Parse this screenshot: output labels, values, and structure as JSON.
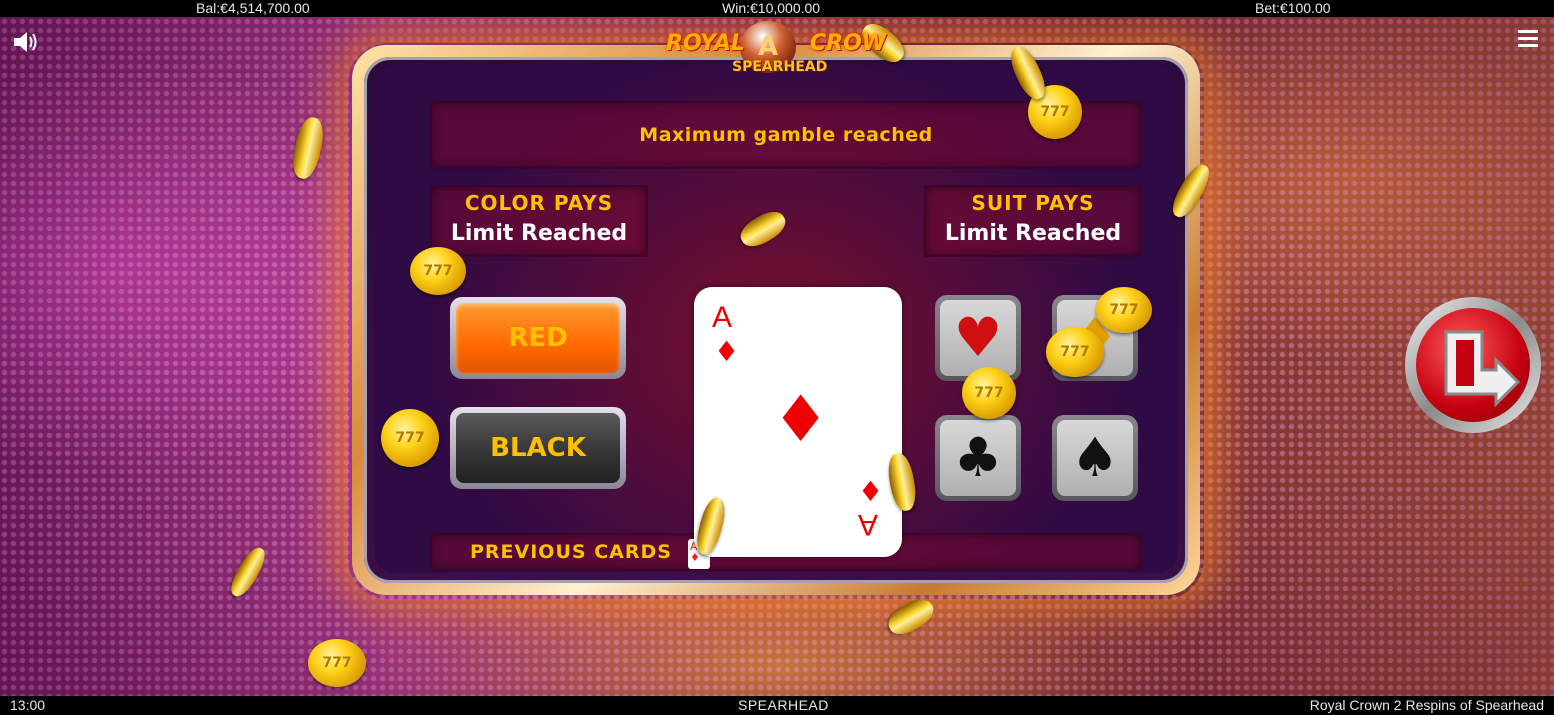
{
  "header": {
    "balance": "Bal:€4,514,700.00",
    "win": "Win:€10,000.00",
    "bet": "Bet:€100.00"
  },
  "logo": {
    "word1": "ROYAL",
    "word2": "CROW",
    "orb_letter": "A",
    "brand": "SPEARHEAD"
  },
  "gamble": {
    "message": "Maximum gamble reached",
    "color_pays": {
      "title": "COLOR PAYS",
      "value": "Limit Reached"
    },
    "suit_pays": {
      "title": "SUIT PAYS",
      "value": "Limit Reached"
    },
    "red_label": "RED",
    "black_label": "BLACK",
    "previous_cards_label": "PREVIOUS CARDS",
    "card": {
      "rank": "A",
      "suit": "♦"
    },
    "previous_card": {
      "rank": "A",
      "suit": "♦"
    },
    "suits": {
      "hearts": "♥",
      "diamonds": "♦",
      "clubs": "♣",
      "spades": "♠"
    }
  },
  "coin_glyph": "777",
  "icons": {
    "speaker": "speaker-icon",
    "menu": "hamburger-menu-icon",
    "exit": "exit-arrow-icon"
  },
  "footer": {
    "time": "13:00",
    "brand": "SPEARHEAD",
    "game_title": "Royal Crown 2 Respins of Spearhead"
  }
}
